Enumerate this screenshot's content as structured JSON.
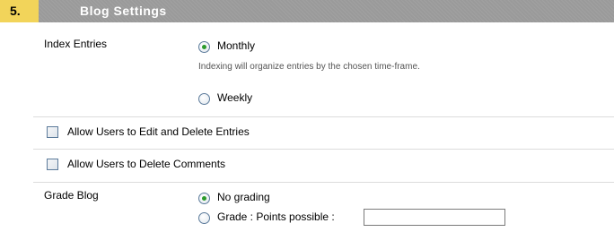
{
  "section": {
    "number": "5.",
    "title": "Blog Settings"
  },
  "index_entries": {
    "label": "Index Entries",
    "options": [
      {
        "label": "Monthly",
        "checked": true
      },
      {
        "label": "Weekly",
        "checked": false
      }
    ],
    "hint": "Indexing will organize entries by the chosen time-frame."
  },
  "permissions": {
    "edit_delete_entries": {
      "label": "Allow Users to Edit and Delete Entries",
      "checked": false
    },
    "delete_comments": {
      "label": "Allow Users to Delete Comments",
      "checked": false
    }
  },
  "grade_blog": {
    "label": "Grade Blog",
    "options": [
      {
        "label": "No grading",
        "checked": true
      },
      {
        "label": "Grade : Points possible :",
        "checked": false
      }
    ],
    "points_value": ""
  },
  "colors": {
    "step_badge": "#f2d45a",
    "title_bar": "#9a9a9a",
    "radio_selected": "#2b9a2b"
  }
}
